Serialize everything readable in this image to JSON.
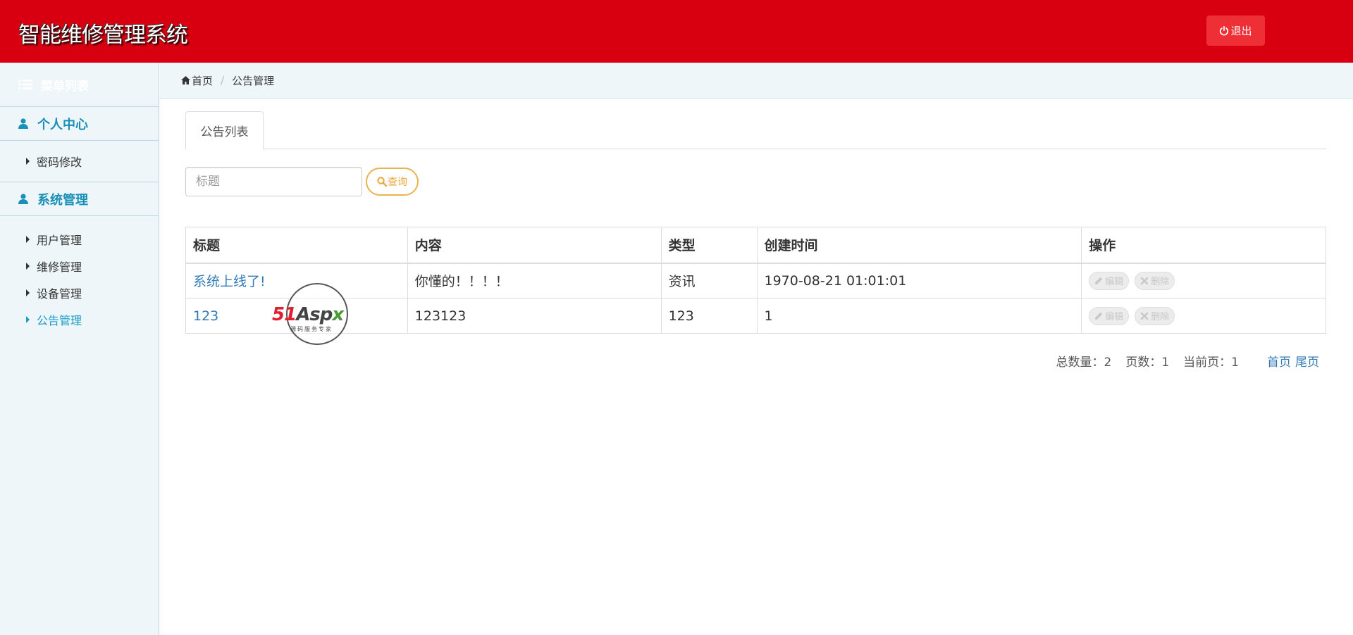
{
  "header": {
    "app_title": "智能维修管理系统",
    "logout_label": "退出",
    "background_color": "#d80010"
  },
  "sidebar": {
    "menu_title": "菜单列表",
    "groups": [
      {
        "title": "个人中心",
        "items": [
          {
            "label": "密码修改"
          }
        ]
      },
      {
        "title": "系统管理",
        "items": [
          {
            "label": "用户管理"
          },
          {
            "label": "维修管理"
          },
          {
            "label": "设备管理"
          },
          {
            "label": "公告管理",
            "active": true
          }
        ]
      }
    ]
  },
  "breadcrumb": {
    "home": "首页",
    "current": "公告管理"
  },
  "tabs": [
    {
      "label": "公告列表",
      "active": true
    }
  ],
  "search": {
    "placeholder": "标题",
    "value": "",
    "button_label": "查询"
  },
  "table": {
    "columns": [
      "标题",
      "内容",
      "类型",
      "创建时间",
      "操作"
    ],
    "rows": [
      {
        "title": "系统上线了!",
        "content": "你懂的！！！！",
        "type": "资讯",
        "created": "1970-08-21 01:01:01",
        "edit": "编辑",
        "delete": "删除"
      },
      {
        "title": "123",
        "content": "123123",
        "type": "123",
        "created": "1",
        "edit": "编辑",
        "delete": "删除"
      }
    ]
  },
  "watermark": {
    "logo_part1": "51",
    "logo_part2": "Asp",
    "logo_part3": "x",
    "tagline": "源码服务专家"
  },
  "pagination": {
    "total_label": "总数量：2",
    "pages_label": "页数：1",
    "current_label": "当前页：1",
    "first_label": "首页",
    "last_label": "尾页"
  }
}
